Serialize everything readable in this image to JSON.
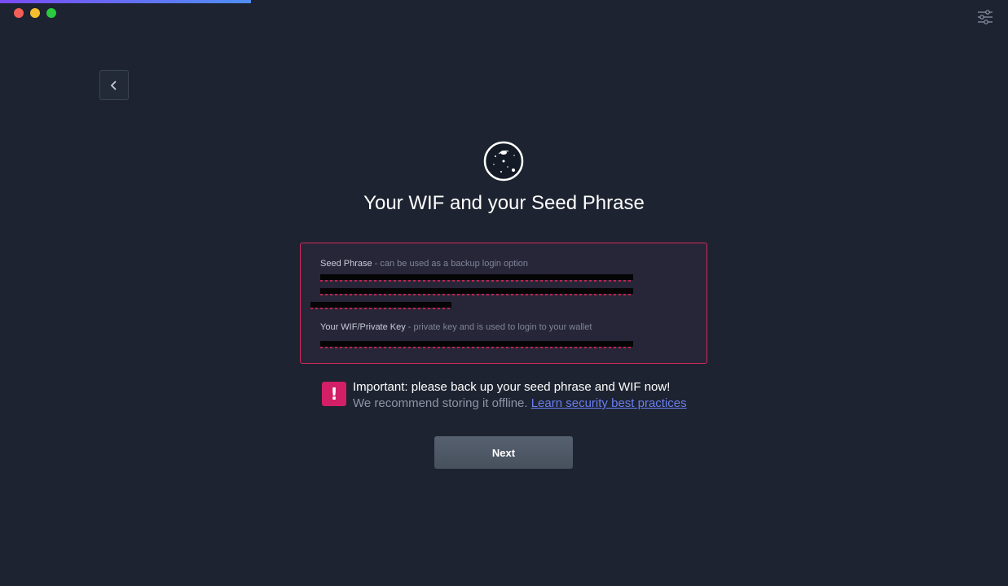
{
  "title": "Your WIF and your Seed Phrase",
  "seed": {
    "label": "Seed Phrase",
    "description": " - can be used as a backup login option"
  },
  "wif": {
    "label": "Your WIF/Private Key",
    "description": " - private key and is used to login to your wallet"
  },
  "notice": {
    "icon": "!",
    "title": "Important: please back up your seed phrase and WIF now!",
    "text": "We recommend storing it offline. ",
    "link": "Learn security best practices"
  },
  "next_label": "Next",
  "colors": {
    "background": "#1d2330",
    "accent_red": "#d22a5d",
    "link": "#6a7ff0"
  },
  "icons": {
    "back": "chevron-left-icon",
    "settings": "sliders-icon",
    "logo": "galaxy-logo-icon"
  }
}
